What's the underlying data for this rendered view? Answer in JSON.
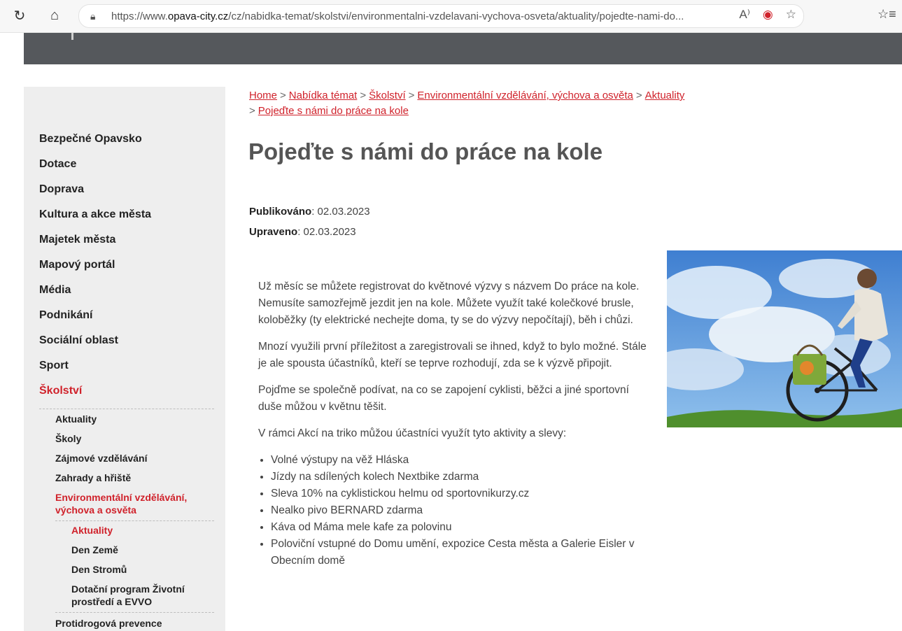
{
  "browser": {
    "url_prefix": "https://www.",
    "url_domain": "opava-city.cz",
    "url_rest": "/cz/nabidka-temat/skolstvi/environmentalni-vzdelavani-vychova-osveta/aktuality/pojedte-nami-do...",
    "icons": [
      "reload-icon",
      "home-icon",
      "lock-icon",
      "read-aloud-icon",
      "tracking-prevention-icon",
      "add-favorite-icon",
      "favorites-icon"
    ]
  },
  "breadcrumb": {
    "items": [
      "Home",
      "Nabídka témat",
      "Školství",
      "Environmentální vzdělávání, výchova a osvěta",
      "Aktuality",
      "Pojeďte s námi do práce na kole"
    ],
    "separator": ">"
  },
  "article": {
    "title": "Pojeďte s námi do práce na kole",
    "published_label": "Publikováno",
    "published_value": ": 02.03.2023",
    "edited_label": "Upraveno",
    "edited_value": ": 02.03.2023",
    "paragraphs": [
      "Už měsíc se můžete registrovat do květnové výzvy s názvem Do práce na kole. Nemusíte samozřejmě jezdit jen na kole. Můžete využít také kolečkové brusle, koloběžky (ty elektrické nechejte doma, ty se do výzvy nepočítají), běh i chůzi.",
      "Mnozí využili první příležitost a zaregistrovali se ihned, když to bylo možné. Stále je ale spousta účastníků, kteří se teprve rozhodují, zda se k výzvě připojit.",
      "Pojďme se společně podívat, na co se zapojení cyklisti, běžci a jiné sportovní duše můžou v květnu těšit.",
      "V rámci Akcí na triko můžou účastníci využít tyto aktivity a slevy:"
    ],
    "list": [
      "Volné výstupy na věž Hláska",
      "Jízdy na sdílených kolech Nextbike zdarma",
      "Sleva 10% na cyklistickou helmu od sportovnikurzy.cz",
      "Nealko pivo BERNARD zdarma",
      "Káva od Máma mele kafe za polovinu",
      "Poloviční vstupné do Domu umění, expozice Cesta města a Galerie Eisler v Obecním domě"
    ]
  },
  "sidebar": {
    "items": [
      "Bezpečné Opavsko",
      "Dotace",
      "Doprava",
      "Kultura a akce města",
      "Majetek města",
      "Mapový portál",
      "Média",
      "Podnikání",
      "Sociální oblast",
      "Sport",
      "Školství"
    ],
    "sub_items": [
      "Aktuality",
      "Školy",
      "Zájmové vzdělávání",
      "Zahrady a hřiště",
      "Environmentální vzdělávání, výchova a osvěta"
    ],
    "sub2_items": [
      "Aktuality",
      "Den Země",
      "Den Stromů",
      "Dotační program Životní prostředí a EVVO"
    ],
    "after_item": "Protidrogová prevence"
  },
  "colors": {
    "accent": "#d0222b",
    "header": "#55585c",
    "sidebar_bg": "#eeeeee"
  }
}
